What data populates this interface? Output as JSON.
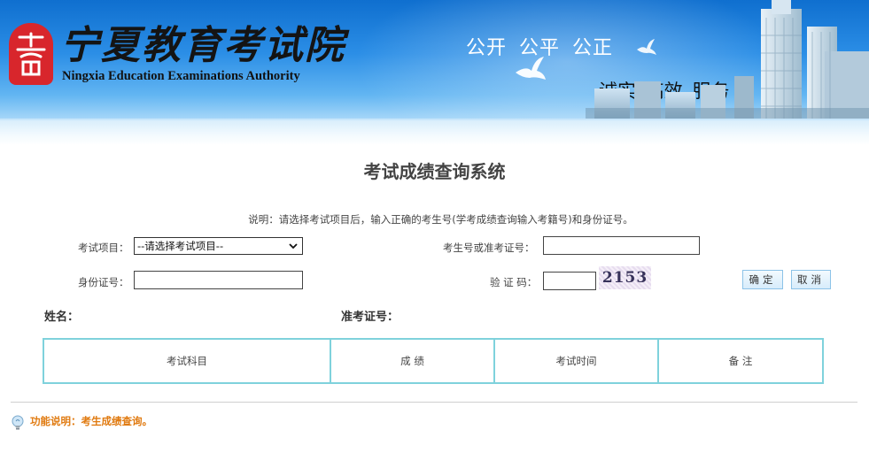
{
  "header": {
    "logo_cn": "宁夏教育考试院",
    "logo_en": "Ningxia Education Examinations Authority",
    "slogan_top": "公开  公平  公正",
    "slogan_bottom": "诚实  高效  服务"
  },
  "page": {
    "title": "考试成绩查询系统",
    "instructions": "说明：请选择考试项目后，输入正确的考生号(学考成绩查询输入考籍号)和身份证号。"
  },
  "form": {
    "exam_label": "考试项目：",
    "exam_selected": "--请选择考试项目--",
    "candidate_label": "考生号或准考证号：",
    "candidate_value": "",
    "id_label": "身份证号：",
    "id_value": "",
    "captcha_label": "验 证 码：",
    "captcha_value": "",
    "captcha_image_text": "2153",
    "confirm_label": "确定",
    "cancel_label": "取消"
  },
  "result": {
    "name_label": "姓名：",
    "ticket_label": "准考证号：",
    "columns": [
      "考试科目",
      "成 绩",
      "考试时间",
      "备 注"
    ]
  },
  "footer": {
    "note": "功能说明：考生成绩查询。"
  },
  "colors": {
    "banner_blue": "#2b8ee6",
    "seal_red": "#d8262c",
    "table_border": "#7fd2dc",
    "note_orange": "#e07a10"
  },
  "icons": [
    "seal-logo-icon",
    "dove-icon",
    "chevron-down-icon",
    "lightbulb-icon"
  ]
}
